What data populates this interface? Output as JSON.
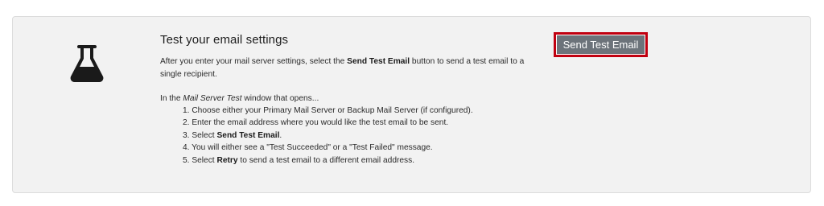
{
  "section": {
    "title": "Test your email settings",
    "description": {
      "prefix": "After you enter your mail server settings, select the ",
      "bold": "Send Test Email",
      "suffix": " button to send a test email to a single recipient."
    },
    "intro": {
      "prefix": "In the ",
      "italic": "Mail Server Test",
      "suffix": " window that opens..."
    },
    "steps": [
      {
        "prefix": "1. Choose either your Primary Mail Server or Backup Mail Server (if configured).",
        "bold": "",
        "suffix": ""
      },
      {
        "prefix": "2. Enter the email address where you would like the test email to be sent.",
        "bold": "",
        "suffix": ""
      },
      {
        "prefix": "3. Select ",
        "bold": "Send Test Email",
        "suffix": "."
      },
      {
        "prefix": "4. You will either see a \"Test Succeeded\" or a \"Test Failed\" message.",
        "bold": "",
        "suffix": ""
      },
      {
        "prefix": "5. Select ",
        "bold": "Retry",
        "suffix": " to send a test email to a different email address."
      }
    ]
  },
  "button": {
    "label": "Send Test Email"
  },
  "icons": {
    "main": "flask-icon"
  },
  "colors": {
    "panel_bg": "#f2f2f2",
    "button_bg": "#6c737a",
    "highlight_border": "#c00010",
    "icon": "#1a1a1a"
  }
}
